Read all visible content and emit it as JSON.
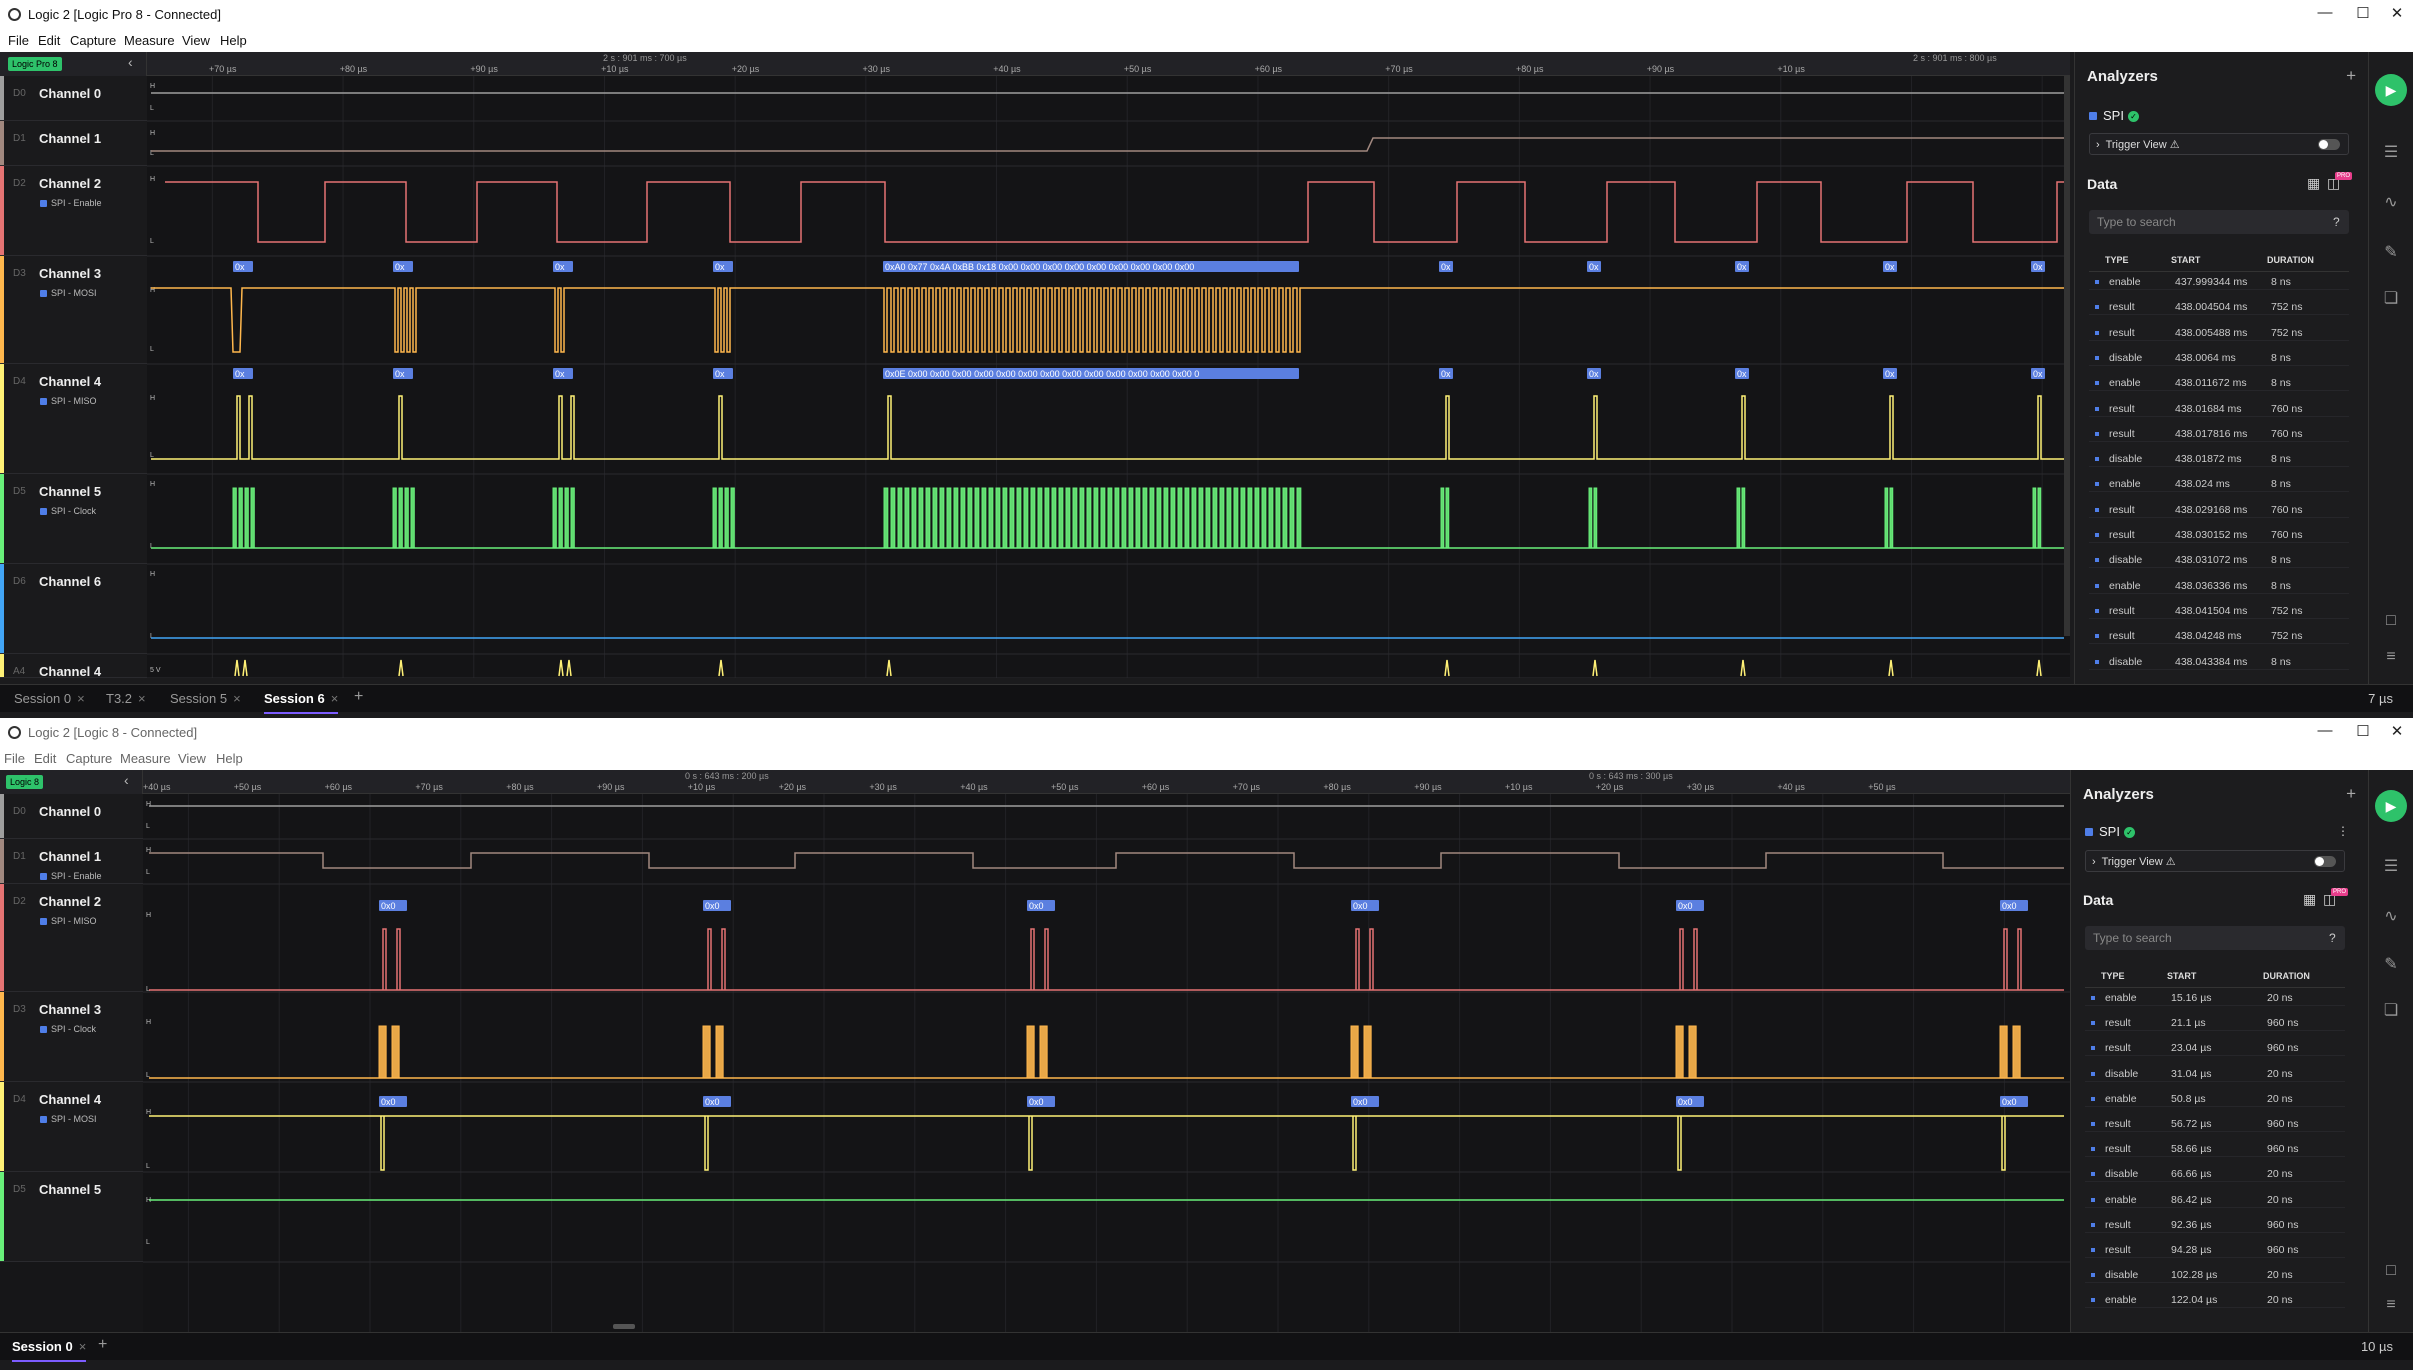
{
  "top": {
    "title": "Logic 2 [Logic Pro 8 - Connected]",
    "menu": [
      "File",
      "Edit",
      "Capture",
      "Measure",
      "View",
      "Help"
    ],
    "device_badge": "Logic Pro 8",
    "ruler_big": [
      "2 s : 901 ms : 700 µs",
      "2 s : 901 ms : 800 µs"
    ],
    "ruler_ticks": [
      "+70 µs",
      "+80 µs",
      "+90 µs",
      "+10 µs",
      "+20 µs",
      "+30 µs",
      "+40 µs",
      "+50 µs",
      "+60 µs",
      "+70 µs",
      "+80 µs",
      "+90 µs",
      "+10 µs"
    ],
    "channels": [
      {
        "id": "D0",
        "name": "Channel 0",
        "sub": "",
        "color": "#9e9e9e"
      },
      {
        "id": "D1",
        "name": "Channel 1",
        "sub": "",
        "color": "#a1887f"
      },
      {
        "id": "D2",
        "name": "Channel 2",
        "sub": "SPI - Enable",
        "color": "#e57373"
      },
      {
        "id": "D3",
        "name": "Channel 3",
        "sub": "SPI - MOSI",
        "color": "#ffb74d"
      },
      {
        "id": "D4",
        "name": "Channel 4",
        "sub": "SPI - MISO",
        "color": "#fff176"
      },
      {
        "id": "D5",
        "name": "Channel 5",
        "sub": "SPI - Clock",
        "color": "#69f07a"
      },
      {
        "id": "D6",
        "name": "Channel 6",
        "sub": "",
        "color": "#42a5f5"
      },
      {
        "id": "A4",
        "name": "Channel 4",
        "sub": "",
        "color": "#fff176"
      }
    ],
    "mosi_long": "0xA0 0x77 0x4A 0xBB 0x18 0x00 0x00 0x00 0x00 0x00 0x00 0x00 0x00 0x00",
    "miso_long": "0x0E 0x00 0x00 0x00 0x00 0x00 0x00 0x00 0x00 0x00 0x00 0x00 0x00 0x00 0",
    "short_label": "0x",
    "tabs": [
      {
        "label": "Session 0",
        "close": "×"
      },
      {
        "label": "T3.2",
        "close": "×"
      },
      {
        "label": "Session 5",
        "close": "×"
      },
      {
        "label": "Session 6",
        "close": "×"
      }
    ],
    "add_tab": "+",
    "zoom": "7 µs",
    "analyzers_title": "Analyzers",
    "analyzer_name": "SPI",
    "trigger_label": "Trigger View ⚠",
    "data_title": "Data",
    "search_placeholder": "Type to search",
    "columns": [
      "TYPE",
      "START",
      "DURATION"
    ],
    "rows": [
      [
        "enable",
        "437.999344 ms",
        "8 ns"
      ],
      [
        "result",
        "438.004504 ms",
        "752 ns"
      ],
      [
        "result",
        "438.005488 ms",
        "752 ns"
      ],
      [
        "disable",
        "438.0064 ms",
        "8 ns"
      ],
      [
        "enable",
        "438.011672 ms",
        "8 ns"
      ],
      [
        "result",
        "438.01684 ms",
        "760 ns"
      ],
      [
        "result",
        "438.017816 ms",
        "760 ns"
      ],
      [
        "disable",
        "438.01872 ms",
        "8 ns"
      ],
      [
        "enable",
        "438.024 ms",
        "8 ns"
      ],
      [
        "result",
        "438.029168 ms",
        "760 ns"
      ],
      [
        "result",
        "438.030152 ms",
        "760 ns"
      ],
      [
        "disable",
        "438.031072 ms",
        "8 ns"
      ],
      [
        "enable",
        "438.036336 ms",
        "8 ns"
      ],
      [
        "result",
        "438.041504 ms",
        "752 ns"
      ],
      [
        "result",
        "438.04248 ms",
        "752 ns"
      ],
      [
        "disable",
        "438.043384 ms",
        "8 ns"
      ]
    ]
  },
  "bottom": {
    "title": "Logic 2 [Logic 8 - Connected]",
    "menu": [
      "File",
      "Edit",
      "Capture",
      "Measure",
      "View",
      "Help"
    ],
    "device_badge": "Logic 8",
    "ruler_big": [
      "0 s : 643 ms : 200 µs",
      "0 s : 643 ms : 300 µs"
    ],
    "ruler_ticks": [
      "+40 µs",
      "+50 µs",
      "+60 µs",
      "+70 µs",
      "+80 µs",
      "+90 µs",
      "+10 µs",
      "+20 µs",
      "+30 µs",
      "+40 µs",
      "+50 µs",
      "+60 µs",
      "+70 µs",
      "+80 µs",
      "+90 µs",
      "+10 µs",
      "+20 µs",
      "+30 µs",
      "+40 µs",
      "+50 µs"
    ],
    "channels": [
      {
        "id": "D0",
        "name": "Channel 0",
        "sub": "",
        "color": "#9e9e9e"
      },
      {
        "id": "D1",
        "name": "Channel 1",
        "sub": "SPI - Enable",
        "color": "#a1887f"
      },
      {
        "id": "D2",
        "name": "Channel 2",
        "sub": "SPI - MISO",
        "color": "#e57373"
      },
      {
        "id": "D3",
        "name": "Channel 3",
        "sub": "SPI - Clock",
        "color": "#ffb74d"
      },
      {
        "id": "D4",
        "name": "Channel 4",
        "sub": "SPI - MOSI",
        "color": "#fff176"
      },
      {
        "id": "D5",
        "name": "Channel 5",
        "sub": "",
        "color": "#69f07a"
      }
    ],
    "short_label": "0x0",
    "tabs": [
      {
        "label": "Session 0",
        "close": "×"
      }
    ],
    "add_tab": "+",
    "zoom": "10 µs",
    "analyzers_title": "Analyzers",
    "analyzer_name": "SPI",
    "trigger_label": "Trigger View ⚠",
    "data_title": "Data",
    "search_placeholder": "Type to search",
    "columns": [
      "TYPE",
      "START",
      "DURATION"
    ],
    "rows": [
      [
        "enable",
        "15.16 µs",
        "20 ns"
      ],
      [
        "result",
        "21.1 µs",
        "960 ns"
      ],
      [
        "result",
        "23.04 µs",
        "960 ns"
      ],
      [
        "disable",
        "31.04 µs",
        "20 ns"
      ],
      [
        "enable",
        "50.8 µs",
        "20 ns"
      ],
      [
        "result",
        "56.72 µs",
        "960 ns"
      ],
      [
        "result",
        "58.66 µs",
        "960 ns"
      ],
      [
        "disable",
        "66.66 µs",
        "20 ns"
      ],
      [
        "enable",
        "86.42 µs",
        "20 ns"
      ],
      [
        "result",
        "92.36 µs",
        "960 ns"
      ],
      [
        "result",
        "94.28 µs",
        "960 ns"
      ],
      [
        "disable",
        "102.28 µs",
        "20 ns"
      ],
      [
        "enable",
        "122.04 µs",
        "20 ns"
      ]
    ]
  },
  "icons": {
    "play": "play-icon",
    "settings": "sliders-icon",
    "analyzer": "waveform-icon",
    "measure": "ruler-icon",
    "extensions": "puzzle-icon",
    "chat": "comment-icon",
    "menu": "hamburger-icon"
  }
}
